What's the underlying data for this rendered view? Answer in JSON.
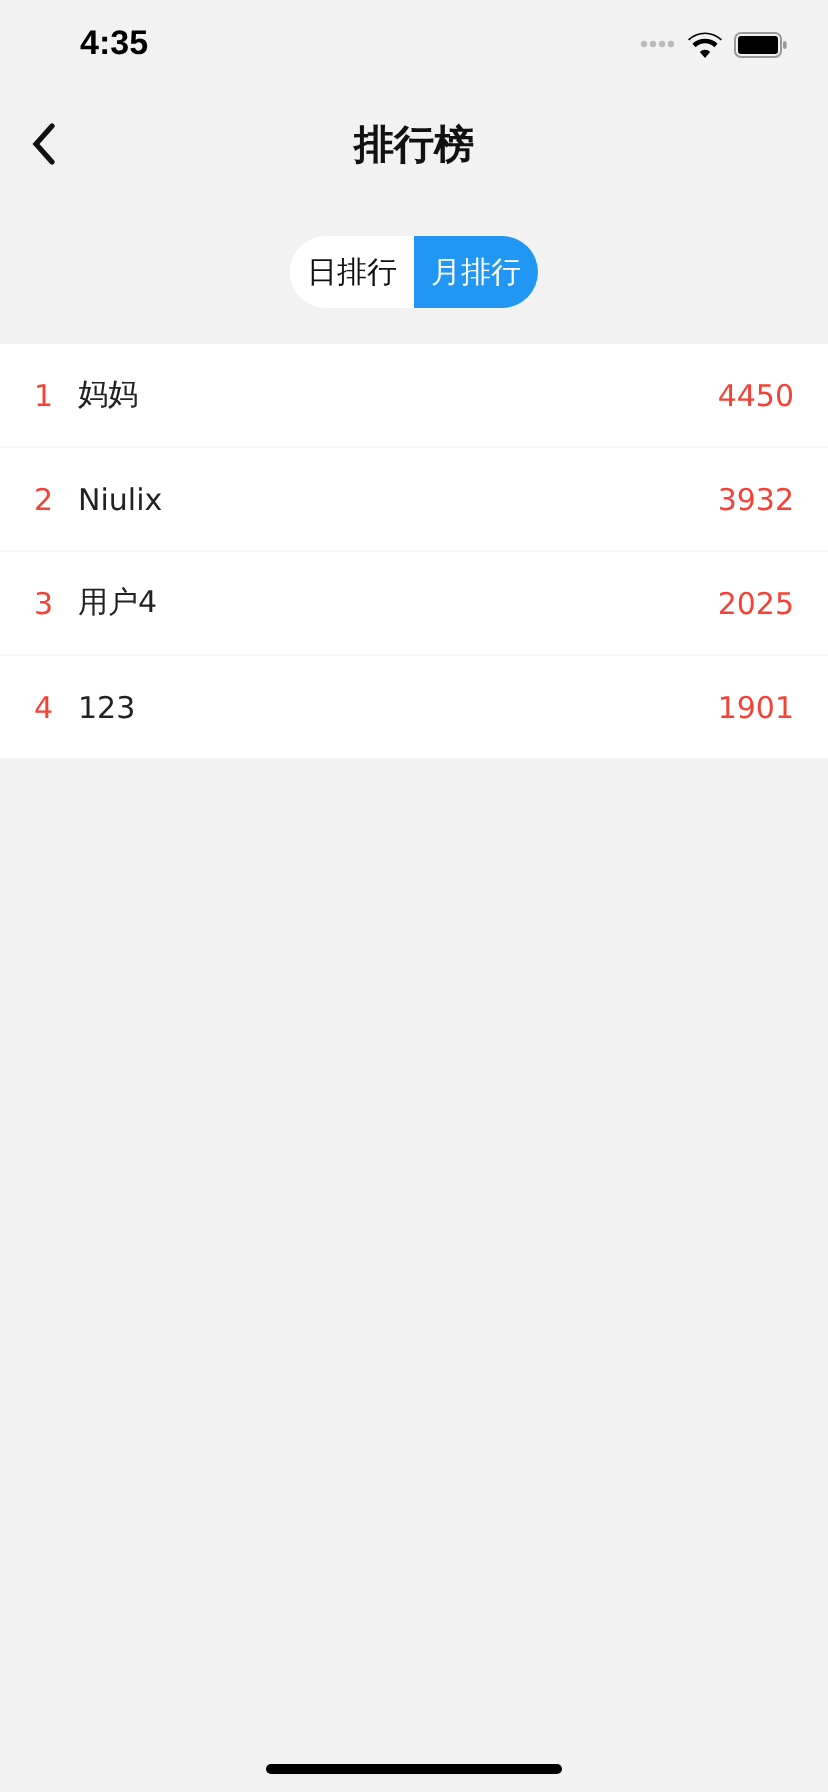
{
  "status_bar": {
    "time": "4:35"
  },
  "nav_bar": {
    "title": "排行榜"
  },
  "tabs": [
    {
      "label": "日排行",
      "selected": false
    },
    {
      "label": "月排行",
      "selected": true
    }
  ],
  "ranking": [
    {
      "rank": "1",
      "name": "妈妈",
      "score": "4450"
    },
    {
      "rank": "2",
      "name": "Niulix",
      "score": "3932"
    },
    {
      "rank": "3",
      "name": "用户4",
      "score": "2025"
    },
    {
      "rank": "4",
      "name": "123",
      "score": "1901"
    }
  ]
}
